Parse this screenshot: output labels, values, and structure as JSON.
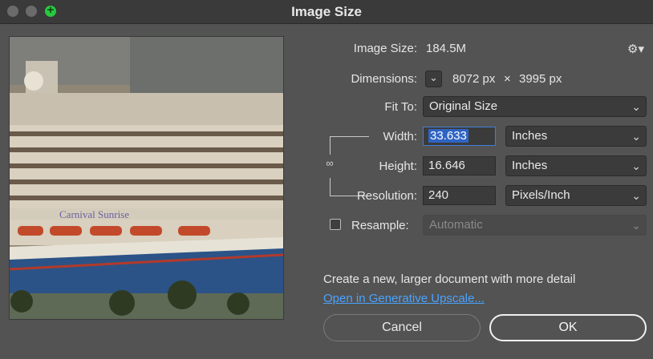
{
  "window": {
    "title": "Image Size"
  },
  "info": {
    "image_size_label": "Image Size:",
    "image_size_value": "184.5M",
    "dimensions_label": "Dimensions:",
    "dimensions_width": "8072 px",
    "dimensions_x": "×",
    "dimensions_height": "3995 px"
  },
  "fit_to": {
    "label": "Fit To:",
    "value": "Original Size"
  },
  "width": {
    "label": "Width:",
    "value": "33.633",
    "unit": "Inches"
  },
  "height": {
    "label": "Height:",
    "value": "16.646",
    "unit": "Inches"
  },
  "resolution": {
    "label": "Resolution:",
    "value": "240",
    "unit": "Pixels/Inch"
  },
  "resample": {
    "label": "Resample:",
    "checked": false,
    "value": "Automatic"
  },
  "upscale": {
    "message": "Create a new, larger document with more detail",
    "link": "Open in Generative Upscale..."
  },
  "buttons": {
    "cancel": "Cancel",
    "ok": "OK"
  },
  "preview": {
    "ship_name": "Carnival Sunrise"
  },
  "icons": {
    "gear": "gear-icon",
    "link": "link-icon",
    "chevron": "chevron-down-icon",
    "zoom": "zoom-plus-icon"
  },
  "colors": {
    "accent": "#2f64c4",
    "link": "#4aa3ff",
    "zoom_green": "#27c93f"
  }
}
